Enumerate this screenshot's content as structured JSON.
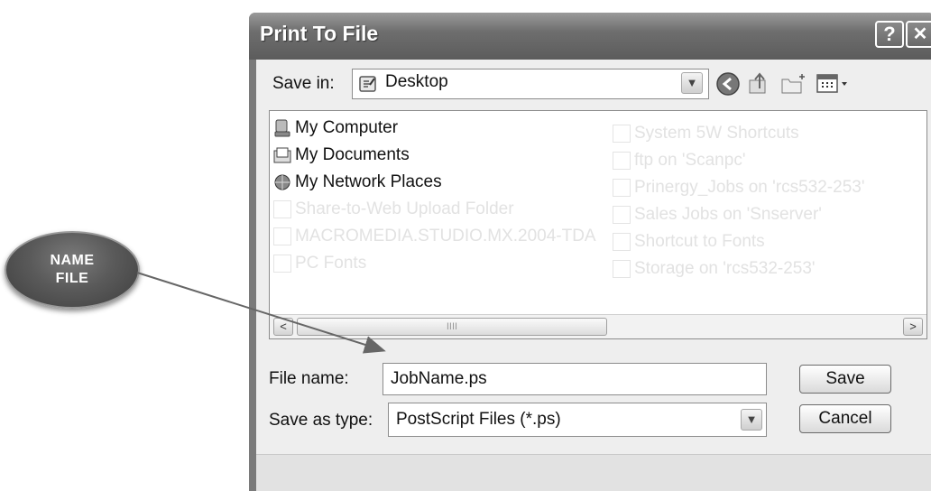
{
  "callout": {
    "line1": "NAME",
    "line2": "FILE"
  },
  "dialog": {
    "title": "Print To File",
    "help_label": "?",
    "close_label": "✕",
    "save_in_label": "Save in:",
    "save_in_value": "Desktop",
    "files_left": [
      "My Computer",
      "My Documents",
      "My Network Places",
      "Share-to-Web Upload Folder",
      "MACROMEDIA.STUDIO.MX.2004-TDA",
      "PC Fonts"
    ],
    "files_right": [
      "System 5W Shortcuts",
      "ftp on 'Scanpc'",
      "Prinergy_Jobs on 'rcs532-253'",
      "Sales Jobs on 'Snserver'",
      "Shortcut to Fonts",
      "Storage on 'rcs532-253'"
    ],
    "scroll_left": "<",
    "scroll_right": ">",
    "scroll_grip": "IIII",
    "file_name_label": "File name:",
    "file_name_value": "JobName.ps",
    "save_type_label": "Save as type:",
    "save_type_value": "PostScript Files (*.ps)",
    "save_button": "Save",
    "cancel_button": "Cancel"
  },
  "icons": [
    "folder-icon",
    "back-icon",
    "up-folder-icon",
    "new-folder-icon",
    "view-menu-icon",
    "my-computer-icon",
    "my-documents-icon",
    "network-places-icon",
    "chevron-down-icon"
  ]
}
